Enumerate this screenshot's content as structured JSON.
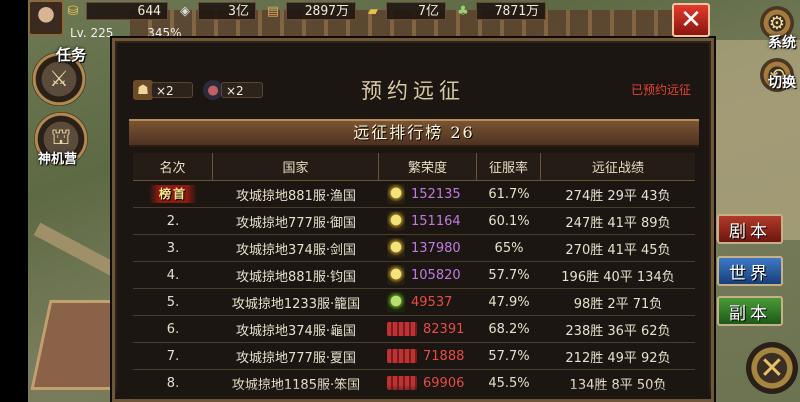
{
  "resources": [
    {
      "icon": "gold-ingot-icon",
      "glyph": "⛁",
      "value": "644"
    },
    {
      "icon": "silver-icon",
      "glyph": "◈",
      "value": "3亿"
    },
    {
      "icon": "wood-icon",
      "glyph": "▤",
      "value": "2897万"
    },
    {
      "icon": "iron-icon",
      "glyph": "▰",
      "value": "7亿"
    },
    {
      "icon": "grain-icon",
      "glyph": "♣",
      "value": "7871万"
    }
  ],
  "player": {
    "level": "Lv. 225",
    "percent": "345%"
  },
  "left_buttons": {
    "task": "任务",
    "workshop": "神机营"
  },
  "right_buttons": {
    "system": "系统",
    "switch": "切换",
    "dungeon1": "剧本",
    "world": "世界",
    "dungeon2": "副本"
  },
  "dialog": {
    "title": "预约远征",
    "booked_label": "已预约远征",
    "items": [
      {
        "icon": "bag-icon",
        "count": "×2"
      },
      {
        "icon": "bomb-icon",
        "count": "×2"
      }
    ],
    "ranking_title": "远征排行榜 26",
    "columns": [
      "名次",
      "国家",
      "繁荣度",
      "征服率",
      "远征战绩"
    ]
  },
  "rows": [
    {
      "rank": "榜首",
      "server": "攻城掠地881服·渔国",
      "medal": "gold",
      "prosperity": "152135",
      "conquest": "61.7%",
      "record": "274胜 29平 43负",
      "pcolor": "purple"
    },
    {
      "rank": "2.",
      "server": "攻城掠地777服·御国",
      "medal": "gold",
      "prosperity": "151164",
      "conquest": "60.1%",
      "record": "247胜 41平 89负",
      "pcolor": "purple"
    },
    {
      "rank": "3.",
      "server": "攻城掠地374服·剑国",
      "medal": "gold",
      "prosperity": "137980",
      "conquest": "65%",
      "record": "270胜 41平 45负",
      "pcolor": "purple"
    },
    {
      "rank": "4.",
      "server": "攻城掠地881服·钧国",
      "medal": "gold",
      "prosperity": "105820",
      "conquest": "57.7%",
      "record": "196胜 40平 134负",
      "pcolor": "purple"
    },
    {
      "rank": "5.",
      "server": "攻城掠地1233服·籠国",
      "medal": "green",
      "prosperity": "49537",
      "conquest": "47.9%",
      "record": "98胜 2平 71负",
      "pcolor": "red"
    },
    {
      "rank": "6.",
      "server": "攻城掠地374服·龜国",
      "medal": "scroll",
      "prosperity": "82391",
      "conquest": "68.2%",
      "record": "238胜 36平 62负",
      "pcolor": "red"
    },
    {
      "rank": "7.",
      "server": "攻城掠地777服·夏国",
      "medal": "scroll",
      "prosperity": "71888",
      "conquest": "57.7%",
      "record": "212胜 49平 92负",
      "pcolor": "red"
    },
    {
      "rank": "8.",
      "server": "攻城掠地1185服·笨国",
      "medal": "scroll",
      "prosperity": "69906",
      "conquest": "45.5%",
      "record": "134胜 8平 50负",
      "pcolor": "red"
    }
  ],
  "colors": {
    "accent_red": "#e5433a",
    "prosperity_purple": "#c07be0",
    "prosperity_red": "#ea4a4a",
    "panel_bg": "#1b1612"
  }
}
